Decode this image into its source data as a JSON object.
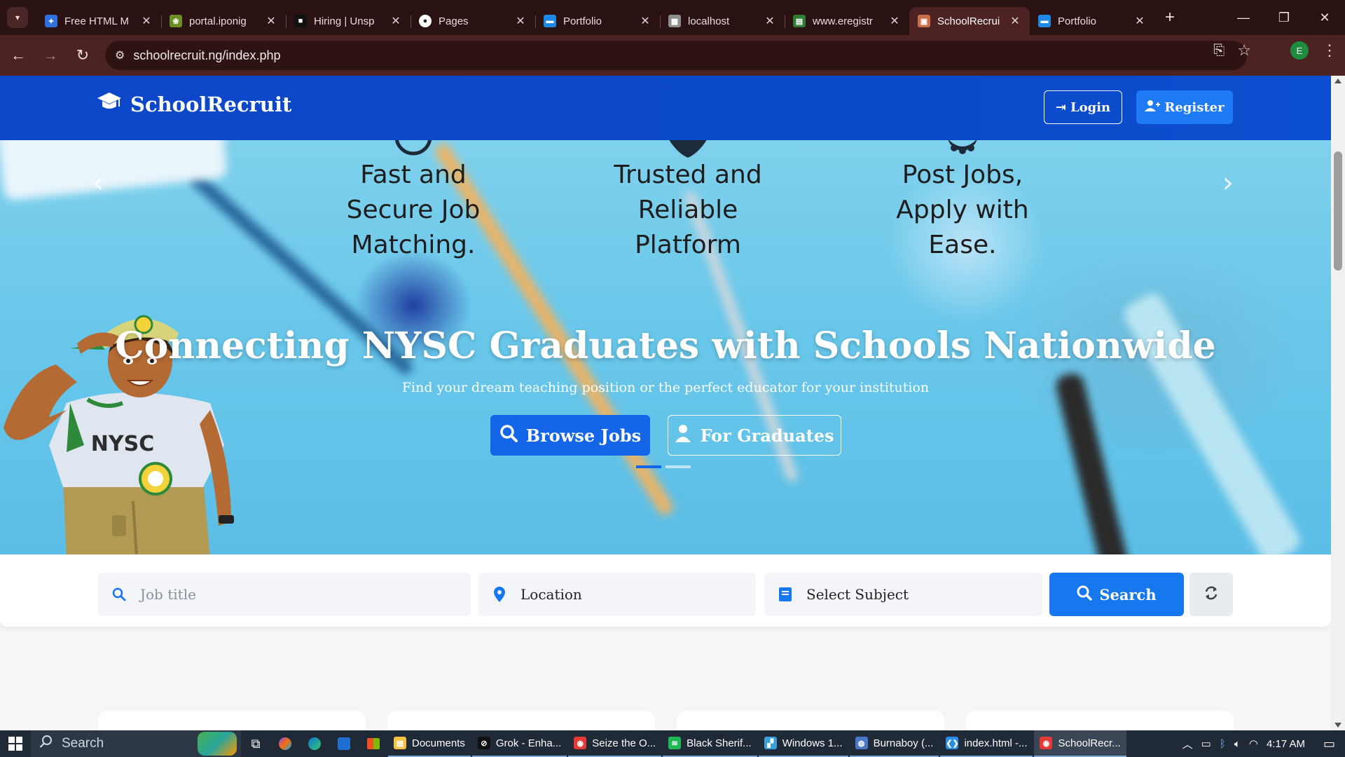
{
  "browser": {
    "tabs": [
      {
        "title": "Free HTML M",
        "favicon_color": "#2f6fde",
        "favicon_glyph": "✦"
      },
      {
        "title": "portal.iponig",
        "favicon_color": "#6b8e23",
        "favicon_glyph": "❀"
      },
      {
        "title": "Hiring | Unsp",
        "favicon_color": "#111111",
        "favicon_glyph": "■"
      },
      {
        "title": "Pages",
        "favicon_color": "#ffffff",
        "favicon_glyph": "●"
      },
      {
        "title": "Portfolio",
        "favicon_color": "#1e88e5",
        "favicon_glyph": "▬"
      },
      {
        "title": "localhost",
        "favicon_color": "#8d8d8d",
        "favicon_glyph": "▦"
      },
      {
        "title": "www.eregistr",
        "favicon_color": "#2e7d32",
        "favicon_glyph": "▤"
      },
      {
        "title": "SchoolRecrui",
        "favicon_color": "#c96d4a",
        "favicon_glyph": "▣",
        "active": true
      },
      {
        "title": "Portfolio",
        "favicon_color": "#1e88e5",
        "favicon_glyph": "▬"
      }
    ],
    "url": "schoolrecruit.ng/index.php",
    "profile_initial": "E"
  },
  "header": {
    "brand": "SchoolRecruit",
    "login_label": "Login",
    "register_label": "Register"
  },
  "hero": {
    "features": [
      {
        "line1": "Fast and",
        "line2": "Secure Job",
        "line3": "Matching."
      },
      {
        "line1": "Trusted and",
        "line2": "Reliable",
        "line3": "Platform"
      },
      {
        "line1": "Post Jobs,",
        "line2": "Apply with",
        "line3": "Ease."
      }
    ],
    "headline": "Connecting NYSC Graduates with Schools Nationwide",
    "subheadline": "Find your dream teaching position or the perfect educator for your institution",
    "browse_label": "Browse Jobs",
    "graduates_label": "For Graduates",
    "shirt_text": "NYSC"
  },
  "search": {
    "job_title_placeholder": "Job title",
    "location_value": "Location",
    "subject_value": "Select Subject",
    "search_label": "Search"
  },
  "taskbar": {
    "search_placeholder": "Search",
    "apps": [
      {
        "label": "Documents",
        "color": "#f5c242",
        "glyph": "▤"
      },
      {
        "label": "Grok - Enha...",
        "color": "#111111",
        "glyph": "⊘"
      },
      {
        "label": "Seize the O...",
        "color": "#e53935",
        "glyph": "◉"
      },
      {
        "label": "Black Sherif...",
        "color": "#1db954",
        "glyph": "≋"
      },
      {
        "label": "Windows 1...",
        "color": "#3aa0d8",
        "glyph": "▞"
      },
      {
        "label": "Burnaboy (...",
        "color": "#4a78c8",
        "glyph": "◍"
      },
      {
        "label": "index.html -...",
        "color": "#2b8ee6",
        "glyph": "❮❯"
      },
      {
        "label": "SchoolRecr...",
        "color": "#e53935",
        "glyph": "◉",
        "active": true
      }
    ],
    "time": "4:17 AM"
  }
}
